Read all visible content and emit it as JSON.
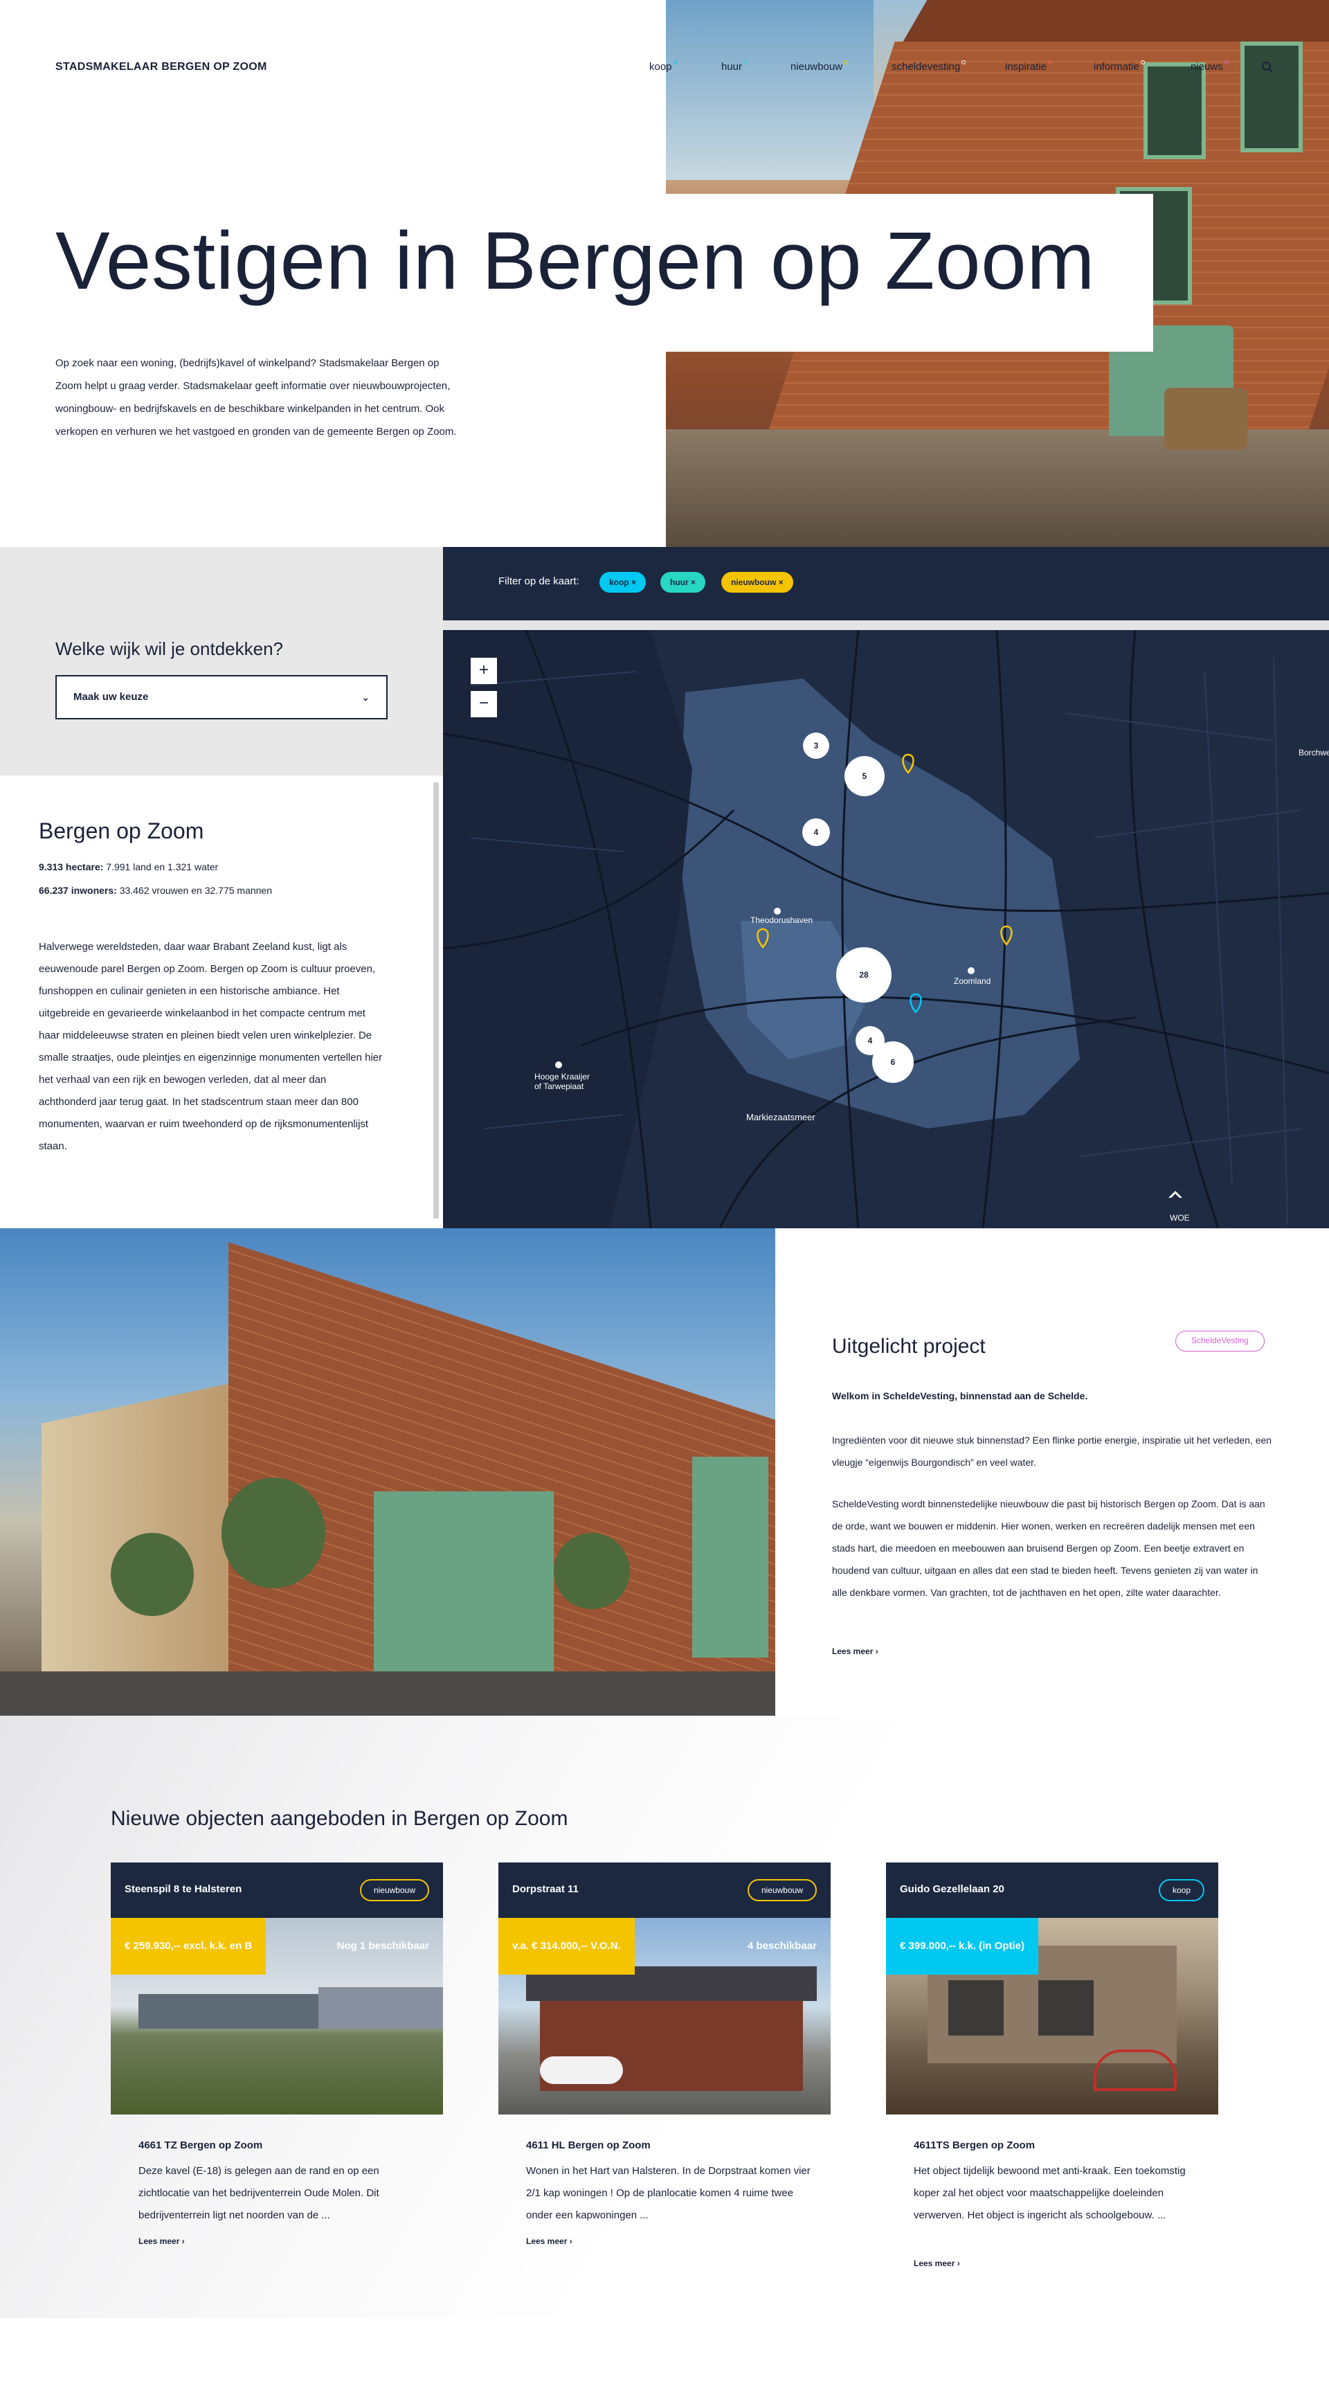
{
  "site": {
    "logo": "STADSMAKELAAR BERGEN OP ZOOM"
  },
  "nav": [
    {
      "label": "koop",
      "color": "#00c8f0"
    },
    {
      "label": "huur",
      "color": "#28d6c4"
    },
    {
      "label": "nieuwbouw",
      "color": "#f5c400"
    },
    {
      "label": "scheldevesting",
      "color": "#ffffff"
    },
    {
      "label": "inspiratie",
      "color": "#ff5a5a"
    },
    {
      "label": "informatie",
      "color": "#ffffff"
    },
    {
      "label": "nieuws",
      "color": "#d35fd0"
    }
  ],
  "hero": {
    "title": "Vestigen in Bergen op Zoom",
    "intro": "Op zoek naar een woning, (bedrijfs)kavel of winkelpand? Stadsmakelaar Bergen op Zoom helpt u graag verder. Stadsmakelaar geeft informatie over nieuwbouwprojecten, woningbouw- en bedrijfskavels en de beschikbare winkelpanden in het centrum. Ook verkopen en verhuren we het vastgoed en gronden van de gemeente Bergen op Zoom."
  },
  "wijk": {
    "question": "Welke wijk wil je ontdekken?",
    "select_value": "Maak uw keuze"
  },
  "info": {
    "title": "Bergen op Zoom",
    "stat1_bold": "9.313 hectare:",
    "stat1_rest": " 7.991 land en 1.321 water",
    "stat2_bold": "66.237 inwoners:",
    "stat2_rest": " 33.462 vrouwen en 32.775 mannen",
    "text": "Halverwege wereldsteden, daar waar Brabant Zeeland kust, ligt als eeuwenoude parel Bergen op Zoom. Bergen op Zoom is cultuur proeven, funshoppen en culinair genieten in een historische ambiance. Het uitgebreide en gevarieerde winkelaanbod in het compacte centrum met haar middeleeuwse straten en pleinen biedt velen uren winkelplezier. De smalle straatjes, oude pleintjes en eigenzinnige monumenten vertellen hier het verhaal van een rijk en bewogen verleden, dat al meer dan achthonderd jaar terug gaat. In het stadscentrum staan meer dan 800 monumenten, waarvan er ruim tweehonderd op de rijksmonumentenlijst staan."
  },
  "filter": {
    "label": "Filter op de kaart:",
    "chips": [
      {
        "label": "koop ×",
        "color": "#00c8f0"
      },
      {
        "label": "huur ×",
        "color": "#28d6c4"
      },
      {
        "label": "nieuwbouw ×",
        "color": "#f5c400"
      }
    ]
  },
  "map": {
    "zoom_in": "+",
    "zoom_out": "−",
    "clusters": [
      "3",
      "5",
      "4",
      "28",
      "4",
      "6"
    ],
    "labels": {
      "theodorushaven": "Theodorushaven",
      "zoomland": "Zoomland",
      "hooge": "Hooge Kraaijer",
      "hooge2": "of Tarwepiaat",
      "markiezaat": "Markiezaatsmeer",
      "woe": "WOE",
      "borchwerf": "Borchwe"
    }
  },
  "featured": {
    "title": "Uitgelicht project",
    "badge": "ScheldeVesting",
    "lead": "Welkom in ScheldeVesting, binnenstad aan de Schelde.",
    "p1": "Ingrediënten voor dit nieuwe stuk binnenstad? Een flinke portie energie, inspiratie uit het verleden, een vleugje “eigenwijs Bourgondisch” en veel water.",
    "p2": "ScheldeVesting wordt binnenstedelijke nieuwbouw die past bij historisch Bergen op Zoom. Dat is aan de orde, want we bouwen er middenin. Hier wonen, werken en recreëren dadelijk mensen met een stads hart, die meedoen en meebouwen aan bruisend Bergen op Zoom. Een beetje extravert en houdend van cultuur, uitgaan en alles dat een stad te bieden heeft. Tevens genieten zij van water in alle denkbare vormen. Van grachten, tot de jachthaven en het open, zilte water daarachter.",
    "more": "Lees meer  ›"
  },
  "objects": {
    "heading": "Nieuwe objecten aangeboden in Bergen op Zoom",
    "cards": [
      {
        "address": "Steenspil 8 te Halsteren",
        "tag": "nieuwbouw",
        "tag_color": "#f5c400",
        "price": "€ 259.930,-- excl. k.k. en B",
        "price_color": "#f5c400",
        "availability": "Nog 1 beschikbaar",
        "zip": "4661 TZ Bergen op Zoom",
        "desc": "Deze kavel (E-18) is gelegen aan de rand en op een zichtlocatie van het bedrijventerrein Oude Molen. Dit bedrijventerrein ligt net noorden van de ...",
        "more": "Lees meer  ›"
      },
      {
        "address": "Dorpstraat 11",
        "tag": "nieuwbouw",
        "tag_color": "#f5c400",
        "price": "v.a. € 314.000,-- V.O.N.",
        "price_color": "#f5c400",
        "availability": "4 beschikbaar",
        "zip": "4611 HL Bergen op Zoom",
        "desc": "Wonen in het Hart van Halsteren. In de Dorpstraat komen vier 2/1 kap woningen ! Op de planlocatie komen 4 ruime twee onder een kapwoningen ...",
        "more": "Lees meer  ›"
      },
      {
        "address": "Guido Gezellelaan 20",
        "tag": "koop",
        "tag_color": "#00c8f0",
        "price": "€ 399.000,-- k.k. (in Optie)",
        "price_color": "#00c8f0",
        "availability": "",
        "zip": "4611TS Bergen op Zoom",
        "desc": "Het object tijdelijk bewoond met anti-kraak. Een toekomstig koper zal het object voor maatschappelijke doeleinden verwerven. Het object is ingericht als schoolgebouw. ...",
        "more": "Lees meer  ›"
      }
    ]
  }
}
